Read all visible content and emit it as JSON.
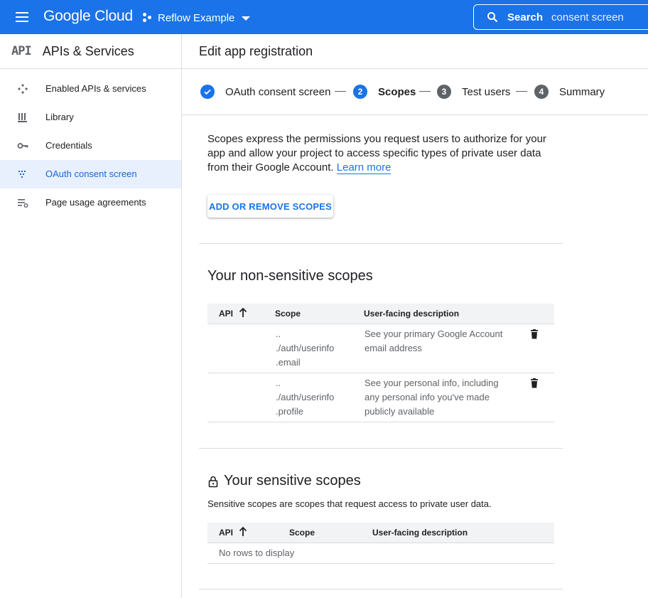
{
  "topbar": {
    "logo": "Google Cloud",
    "project": "Reflow Example",
    "search_label": "Search",
    "search_value": "consent screen"
  },
  "sidebar": {
    "logo_text": "API",
    "title": "APIs & Services",
    "items": [
      {
        "label": "Enabled APIs & services",
        "icon": "diamond-icon",
        "active": false
      },
      {
        "label": "Library",
        "icon": "library-icon",
        "active": false
      },
      {
        "label": "Credentials",
        "icon": "key-icon",
        "active": false
      },
      {
        "label": "OAuth consent screen",
        "icon": "consent-icon",
        "active": true
      },
      {
        "label": "Page usage agreements",
        "icon": "list-settings-icon",
        "active": false
      }
    ]
  },
  "main": {
    "title": "Edit app registration"
  },
  "stepper": {
    "steps": [
      {
        "number": "",
        "label": "OAuth consent screen",
        "state": "done"
      },
      {
        "number": "2",
        "label": "Scopes",
        "state": "current"
      },
      {
        "number": "3",
        "label": "Test users",
        "state": "pending"
      },
      {
        "number": "4",
        "label": "Summary",
        "state": "pending"
      }
    ]
  },
  "content": {
    "intro": "Scopes express the permissions you request users to authorize for your app and allow your project to access specific types of private user data from their Google Account.",
    "learn_more": "Learn more",
    "add_button": "ADD OR REMOVE SCOPES"
  },
  "non_sensitive": {
    "title": "Your non-sensitive scopes",
    "columns": [
      "API",
      "Scope",
      "User-facing description"
    ],
    "rows": [
      {
        "api": "",
        "scope_lines": [
          "..",
          "./auth/userinfo",
          ".email"
        ],
        "description": "See your primary Google Account email address"
      },
      {
        "api": "",
        "scope_lines": [
          "..",
          "./auth/userinfo",
          ".profile"
        ],
        "description": "See your personal info, including any personal info you've made publicly available"
      }
    ]
  },
  "sensitive": {
    "title": "Your sensitive scopes",
    "description": "Sensitive scopes are scopes that request access to private user data.",
    "columns": [
      "API",
      "Scope",
      "User-facing description"
    ],
    "empty_text": "No rows to display"
  },
  "colors": {
    "brand": "#1a73e8",
    "active_bg": "#e8f0fe",
    "pending_step": "#5f6368"
  }
}
